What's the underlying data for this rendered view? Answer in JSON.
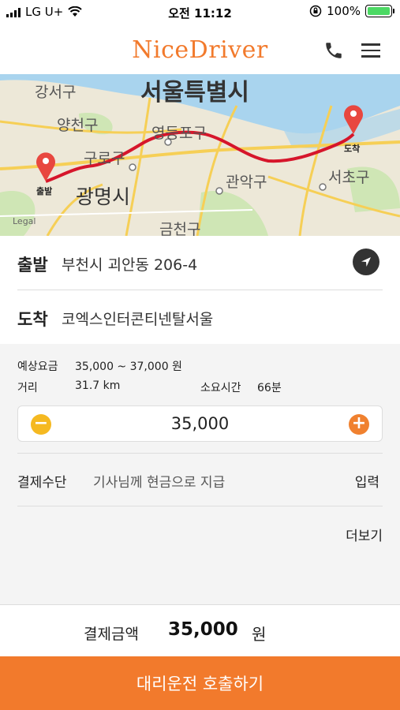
{
  "status_bar": {
    "carrier": "LG U+",
    "time": "오전 11:12",
    "battery": "100%"
  },
  "header": {
    "logo": "NiceDriver",
    "icons": [
      "phone-icon",
      "menu-icon"
    ]
  },
  "map": {
    "labels": {
      "gangseo": "강서구",
      "seoul": "서울특별시",
      "yangcheon": "양천구",
      "yeongdeungpo": "영등포구",
      "guro": "구로구",
      "gwangmyeong": "광명시",
      "gwanak": "관악구",
      "seocho": "서초구",
      "geumcheon": "금천구",
      "legal": "Legal"
    },
    "start_marker": "출발",
    "end_marker": "도착",
    "route_color": "#d6162b"
  },
  "departure": {
    "label": "출발",
    "value": "부천시 괴안동 206-4"
  },
  "arrival": {
    "label": "도착",
    "value": "코엑스인터콘티넨탈서울"
  },
  "estimate": {
    "fare_label": "예상요금",
    "fare_value": "35,000 ~ 37,000 원",
    "distance_label": "거리",
    "distance_value": "31.7 km",
    "duration_label": "소요시간",
    "duration_value": "66분"
  },
  "stepper": {
    "value": "35,000",
    "minus": "−",
    "plus": "+"
  },
  "payment": {
    "label": "결제수단",
    "value": "기사님께 현금으로 지급",
    "action": "입력"
  },
  "more": "더보기",
  "total": {
    "label": "결제금액",
    "amount": "35,000",
    "unit": "원"
  },
  "cta": "대리운전 호출하기",
  "colors": {
    "accent": "#f27a2c",
    "minus": "#f5b921",
    "plus": "#f0812f"
  }
}
